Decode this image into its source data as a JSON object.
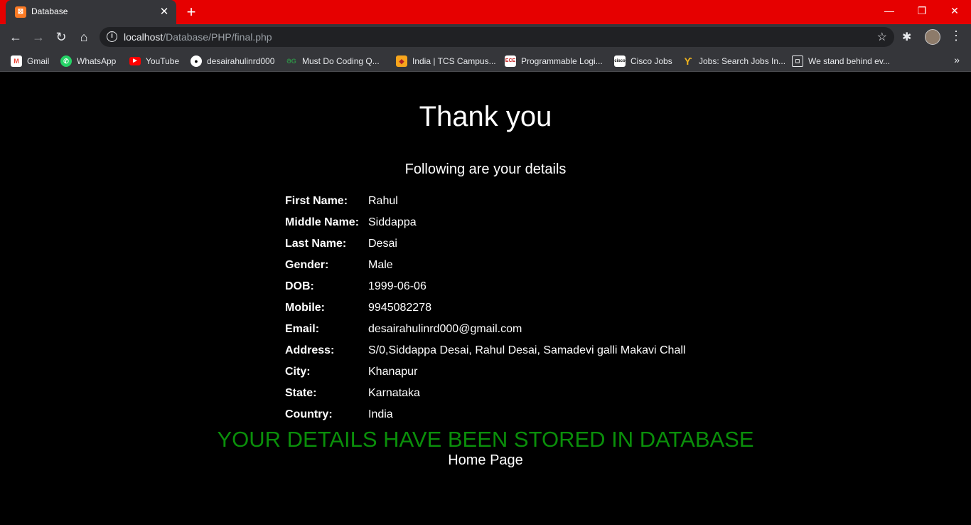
{
  "tab": {
    "title": "Database"
  },
  "address": {
    "host": "localhost",
    "path": "/Database/PHP/final.php"
  },
  "bookmarks": [
    {
      "label": "Gmail",
      "icon": "gmail-icon",
      "color": "#ea4335"
    },
    {
      "label": "WhatsApp",
      "icon": "whatsapp-icon",
      "color": "#25d366"
    },
    {
      "label": "YouTube",
      "icon": "youtube-icon",
      "color": "#ff0000"
    },
    {
      "label": "desairahulinrd000",
      "icon": "github-icon",
      "color": "#ffffff"
    },
    {
      "label": "Must Do Coding Q...",
      "icon": "geeksforgeeks-icon",
      "color": "#2f8d46"
    },
    {
      "label": "India | TCS Campus...",
      "icon": "tcs-icon",
      "color": "#f7a51c"
    },
    {
      "label": "Programmable Logi...",
      "icon": "ece-icon",
      "color": "#c62828"
    },
    {
      "label": "Cisco Jobs",
      "icon": "cisco-icon",
      "color": "#ffffff"
    },
    {
      "label": "Jobs: Search Jobs In...",
      "icon": "jobs-icon",
      "color": "#f2b51d"
    },
    {
      "label": "We stand behind ev...",
      "icon": "page-icon",
      "color": "#ffffff"
    }
  ],
  "page": {
    "heading": "Thank you",
    "subheading": "Following are your details",
    "details": [
      {
        "label": "First Name:",
        "value": "Rahul"
      },
      {
        "label": "Middle Name:",
        "value": "Siddappa"
      },
      {
        "label": "Last Name:",
        "value": "Desai"
      },
      {
        "label": "Gender:",
        "value": "Male"
      },
      {
        "label": "DOB:",
        "value": "1999-06-06"
      },
      {
        "label": "Mobile:",
        "value": "9945082278"
      },
      {
        "label": "Email:",
        "value": "desairahulinrd000@gmail.com"
      },
      {
        "label": "Address:",
        "value": "S/0,Siddappa Desai, Rahul Desai, Samadevi galli Makavi Chall"
      },
      {
        "label": "City:",
        "value": "Khanapur"
      },
      {
        "label": "State:",
        "value": "Karnataka"
      },
      {
        "label": "Country:",
        "value": "India"
      }
    ],
    "stored_message": "YOUR DETAILS HAVE BEEN STORED IN DATABASE",
    "home_link": "Home Page"
  },
  "colors": {
    "titlebar": "#e60000",
    "success": "#0a8f0a"
  }
}
